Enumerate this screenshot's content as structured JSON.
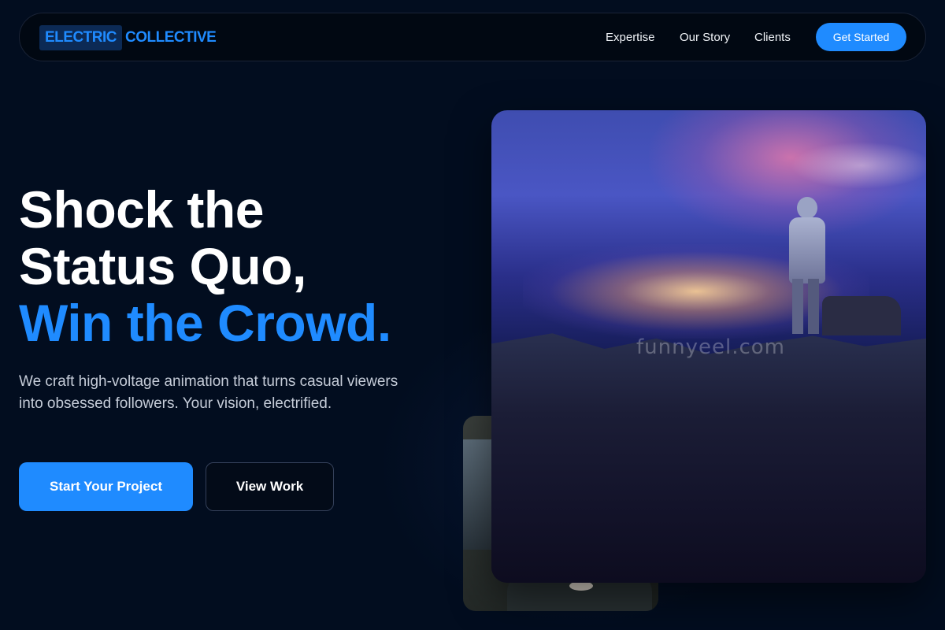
{
  "logo": {
    "part1": "ELECTRIC",
    "part2": "COLLECTIVE"
  },
  "nav": {
    "links": [
      "Expertise",
      "Our Story",
      "Clients"
    ],
    "cta": "Get Started"
  },
  "hero": {
    "title_line1": "Shock the",
    "title_line2": "Status Quo,",
    "title_line3": "Win the Crowd.",
    "subtitle": "We craft high-voltage animation that turns casual viewers into obsessed followers. Your vision, electrified.",
    "primary_button": "Start Your Project",
    "secondary_button": "View Work"
  },
  "images": {
    "watermark": "funnyeel.com"
  },
  "colors": {
    "background": "#020d1f",
    "accent": "#1f8bff"
  }
}
